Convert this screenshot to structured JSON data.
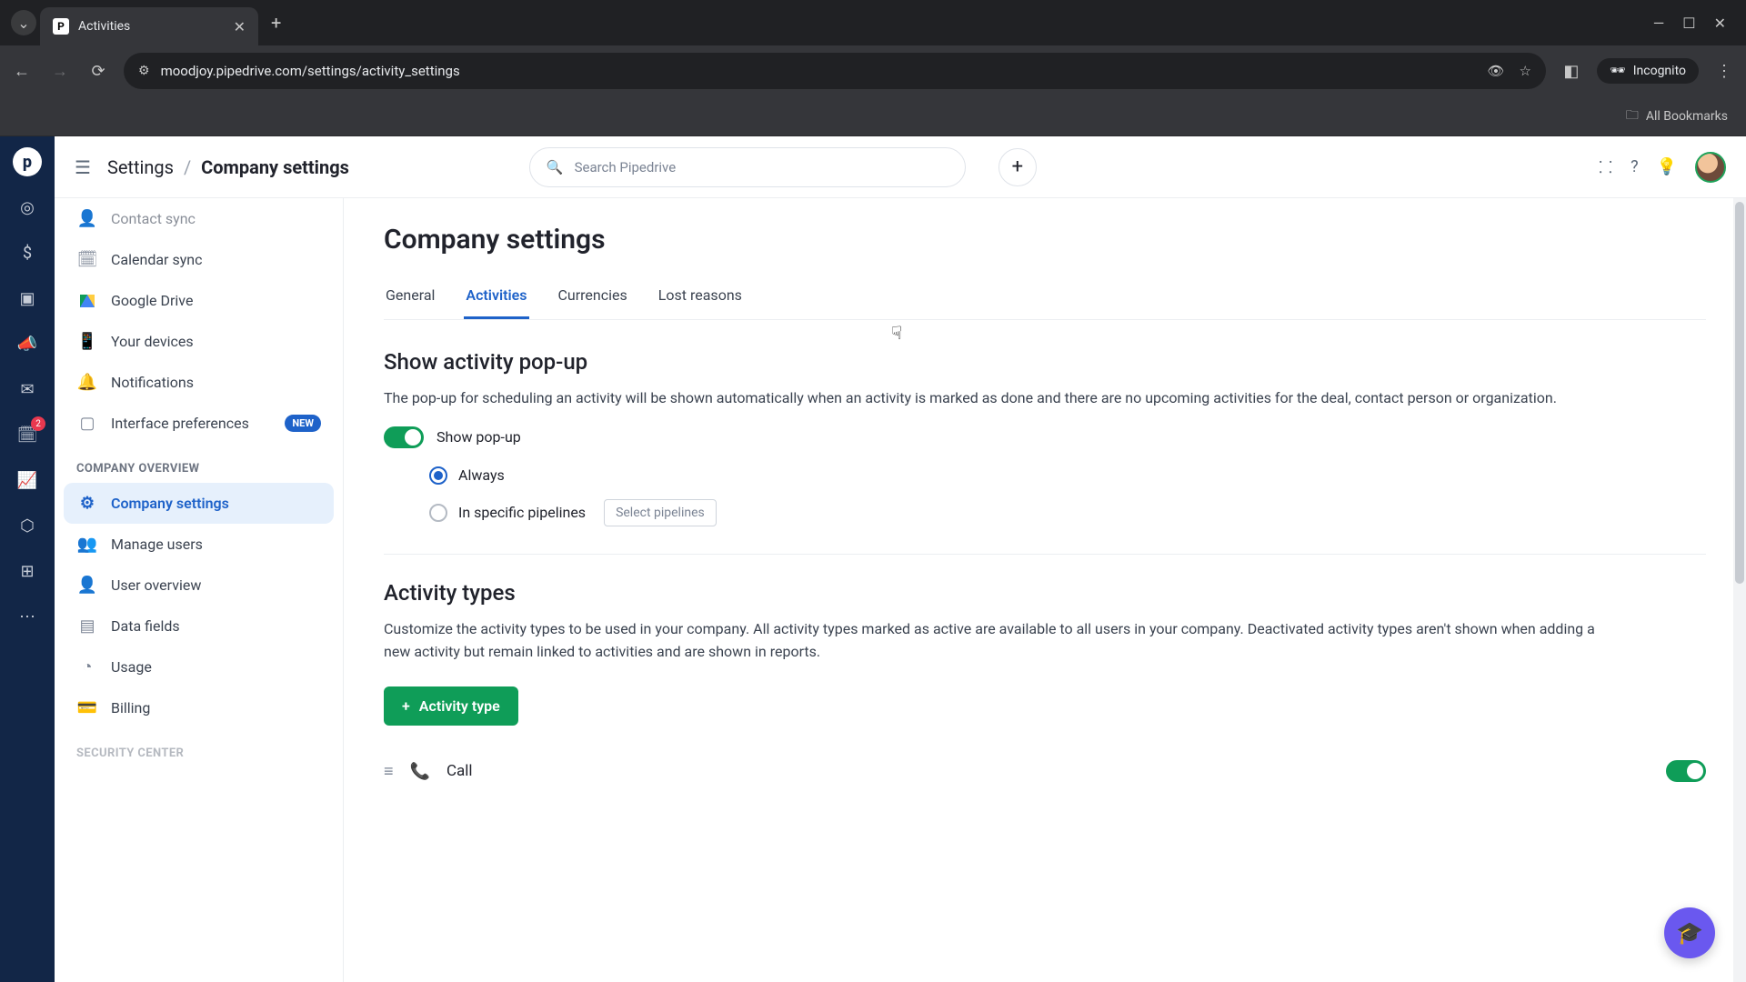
{
  "browser": {
    "tab_title": "Activities",
    "url": "moodjoy.pipedrive.com/settings/activity_settings",
    "incognito_label": "Incognito",
    "all_bookmarks": "All Bookmarks"
  },
  "rail": {
    "badge": "2"
  },
  "header": {
    "breadcrumb_root": "Settings",
    "breadcrumb_current": "Company settings",
    "search_placeholder": "Search Pipedrive"
  },
  "sidebar": {
    "items_top": [
      {
        "label": "Contact sync"
      },
      {
        "label": "Calendar sync"
      },
      {
        "label": "Google Drive"
      },
      {
        "label": "Your devices"
      },
      {
        "label": "Notifications"
      },
      {
        "label": "Interface preferences",
        "badge": "NEW"
      }
    ],
    "section_company": "COMPANY OVERVIEW",
    "items_company": [
      {
        "label": "Company settings"
      },
      {
        "label": "Manage users"
      },
      {
        "label": "User overview"
      },
      {
        "label": "Data fields"
      },
      {
        "label": "Usage"
      },
      {
        "label": "Billing"
      }
    ],
    "section_security": "SECURITY CENTER"
  },
  "main": {
    "page_title": "Company settings",
    "tabs": [
      "General",
      "Activities",
      "Currencies",
      "Lost reasons"
    ],
    "section1": {
      "title": "Show activity pop-up",
      "desc": "The pop-up for scheduling an activity will be shown automatically when an activity is marked as done and there are no upcoming activities for the deal, contact person or organization.",
      "toggle_label": "Show pop-up",
      "option_always": "Always",
      "option_specific": "In specific pipelines",
      "select_pipelines": "Select pipelines"
    },
    "section2": {
      "title": "Activity types",
      "desc": "Customize the activity types to be used in your company. All activity types marked as active are available to all users in your company. Deactivated activity types aren't shown when adding a new activity but remain linked to activities and are shown in reports.",
      "add_button": "Activity type",
      "first_row": "Call"
    }
  }
}
